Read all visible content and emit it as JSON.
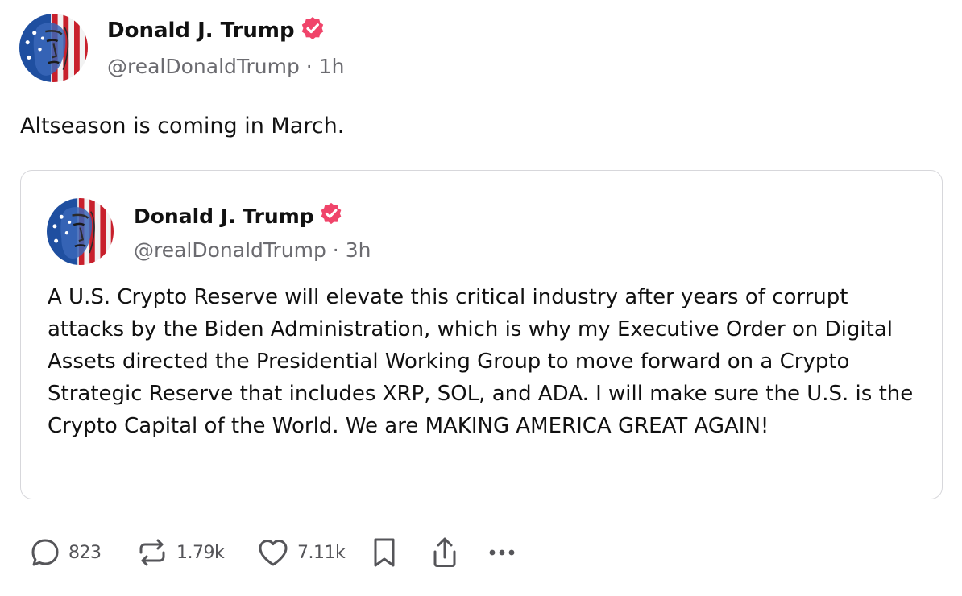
{
  "main_post": {
    "author_name": "Donald J. Trump",
    "handle": "@realDonaldTrump",
    "separator": "·",
    "time": "1h",
    "text": "Altseason is coming in March."
  },
  "quoted_post": {
    "author_name": "Donald J. Trump",
    "handle": "@realDonaldTrump",
    "separator": "·",
    "time": "3h",
    "text": "A U.S. Crypto Reserve will elevate this critical industry after years of corrupt attacks by the Biden Administration, which is why my Executive Order on Digital Assets directed the Presidential Working Group to move forward on a Crypto Strategic Reserve that includes XRP, SOL, and ADA. I will make sure the U.S. is the Crypto Capital of the World. We are MAKING AMERICA GREAT AGAIN!"
  },
  "actions": {
    "reply_count": "823",
    "repost_count": "1.79k",
    "like_count": "7.11k"
  },
  "icons": {
    "verified": "verified-badge-icon",
    "reply": "reply-icon",
    "repost": "repost-icon",
    "like": "heart-icon",
    "save": "bookmark-icon",
    "share": "share-icon",
    "more": "more-icon"
  },
  "colors": {
    "verified_badge": "#f0446a",
    "text": "#111111",
    "secondary_text": "#6b6b70",
    "card_border": "#d7d7db",
    "action_icon": "#555559"
  }
}
